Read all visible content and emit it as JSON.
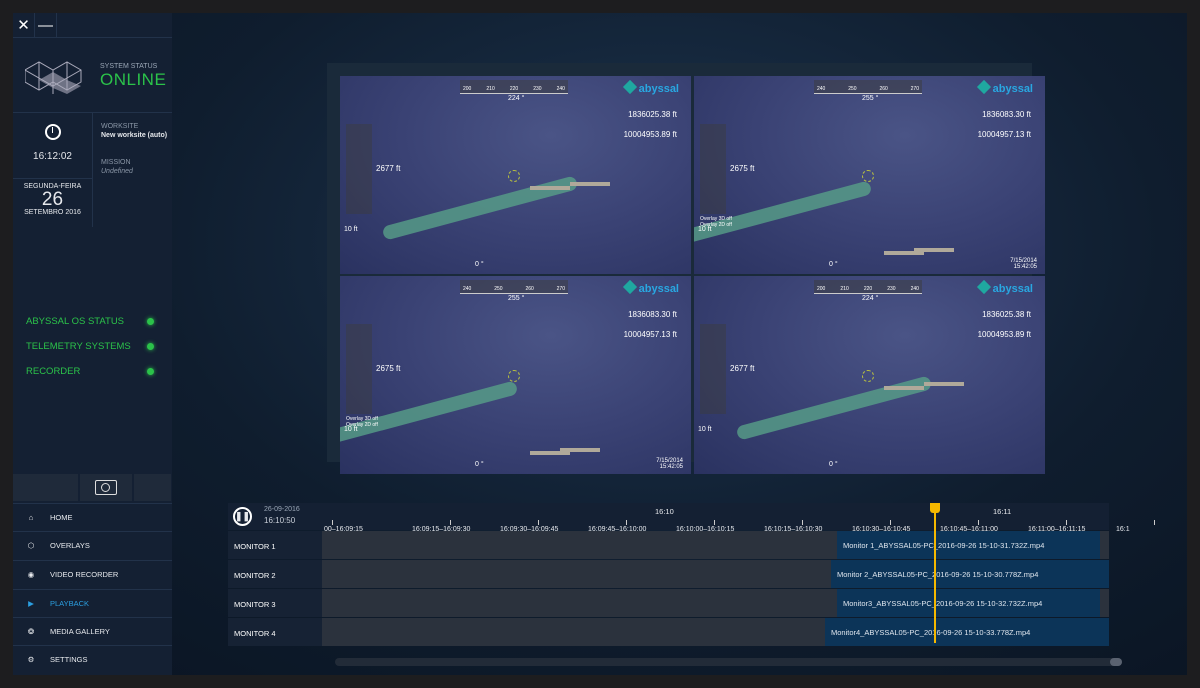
{
  "window": {
    "close": "✕",
    "minimize": "—"
  },
  "status": {
    "label": "SYSTEM STATUS",
    "value": "ONLINE"
  },
  "clock": {
    "time": "16:12:02",
    "weekday": "SEGUNDA-FEIRA",
    "day": "26",
    "month_year": "SETEMBRO 2016"
  },
  "worksite": {
    "label": "WORKSITE",
    "value": "New worksite (auto)",
    "mission_label": "MISSION",
    "mission_value": "Undefined"
  },
  "systems": [
    {
      "label": "ABYSSAL OS STATUS",
      "color": "#2bc24a"
    },
    {
      "label": "TELEMETRY SYSTEMS",
      "color": "#2bc24a"
    },
    {
      "label": "RECORDER",
      "color": "#2bc24a"
    }
  ],
  "nav": [
    {
      "label": "HOME",
      "icon": "home-icon"
    },
    {
      "label": "OVERLAYS",
      "icon": "crosshair-hex-icon"
    },
    {
      "label": "VIDEO RECORDER",
      "icon": "record-hex-icon"
    },
    {
      "label": "PLAYBACK",
      "icon": "play-hex-icon",
      "active": true
    },
    {
      "label": "MEDIA GALLERY",
      "icon": "aperture-icon"
    },
    {
      "label": "SETTINGS",
      "icon": "gear-icon"
    }
  ],
  "feeds": [
    {
      "brand": "abyssal",
      "heading": "224 °",
      "north": "1836025.38 ft",
      "east": "10004953.89 ft",
      "depth": "2677 ft",
      "altitude": "10 ft",
      "roll": "0 °",
      "compass": [
        "200",
        "210",
        "220",
        "230",
        "240"
      ]
    },
    {
      "brand": "abyssal",
      "heading": "255 °",
      "north": "1836083.30 ft",
      "east": "10004957.13 ft",
      "depth": "2675 ft",
      "altitude": "10 ft",
      "roll": "0 °",
      "compass": [
        "240",
        "250",
        "260",
        "270"
      ],
      "overlay": "Overlay 3D off\nOverlay 2D off",
      "date": "7/15/2014",
      "time": "15:42:05"
    },
    {
      "brand": "abyssal",
      "heading": "255 °",
      "north": "1836083.30 ft",
      "east": "10004957.13 ft",
      "depth": "2675 ft",
      "altitude": "10 ft",
      "roll": "0 °",
      "compass": [
        "240",
        "250",
        "260",
        "270"
      ],
      "overlay": "Overlay 3D off\nOverlay 2D off",
      "date": "7/15/2014",
      "time": "15:42:05"
    },
    {
      "brand": "abyssal",
      "heading": "224 °",
      "north": "1836025.38 ft",
      "east": "10004953.89 ft",
      "depth": "2677 ft",
      "altitude": "10 ft",
      "roll": "0 °",
      "compass": [
        "200",
        "210",
        "220",
        "230",
        "240"
      ]
    }
  ],
  "timeline": {
    "date": "26-09-2016",
    "time": "16:10:50",
    "major": [
      "16:10",
      "16:11"
    ],
    "ticks": [
      "00–16:09:15",
      "16:09:15–16:09:30",
      "16:09:30–16:09:45",
      "16:09:45–16:10:00",
      "16:10:00–16:10:15",
      "16:10:15–16:10:30",
      "16:10:30–16:10:45",
      "16:10:45–16:11:00",
      "16:11:00–16:11:15",
      "16:1"
    ],
    "rows": [
      {
        "label": "MONITOR 1",
        "clip": "Monitor 1_ABYSSAL05-PC_2016-09-26 15-10-31.732Z.mp4"
      },
      {
        "label": "MONITOR 2",
        "clip": "Monitor 2_ABYSSAL05-PC_2016-09-26 15-10-30.778Z.mp4"
      },
      {
        "label": "MONITOR 3",
        "clip": "Monitor3_ABYSSAL05-PC_2016-09-26 15-10-32.732Z.mp4"
      },
      {
        "label": "MONITOR 4",
        "clip": "Monitor4_ABYSSAL05-PC_2016-09-26 15-10-33.778Z.mp4"
      }
    ],
    "playhead_color": "#f5b800"
  }
}
